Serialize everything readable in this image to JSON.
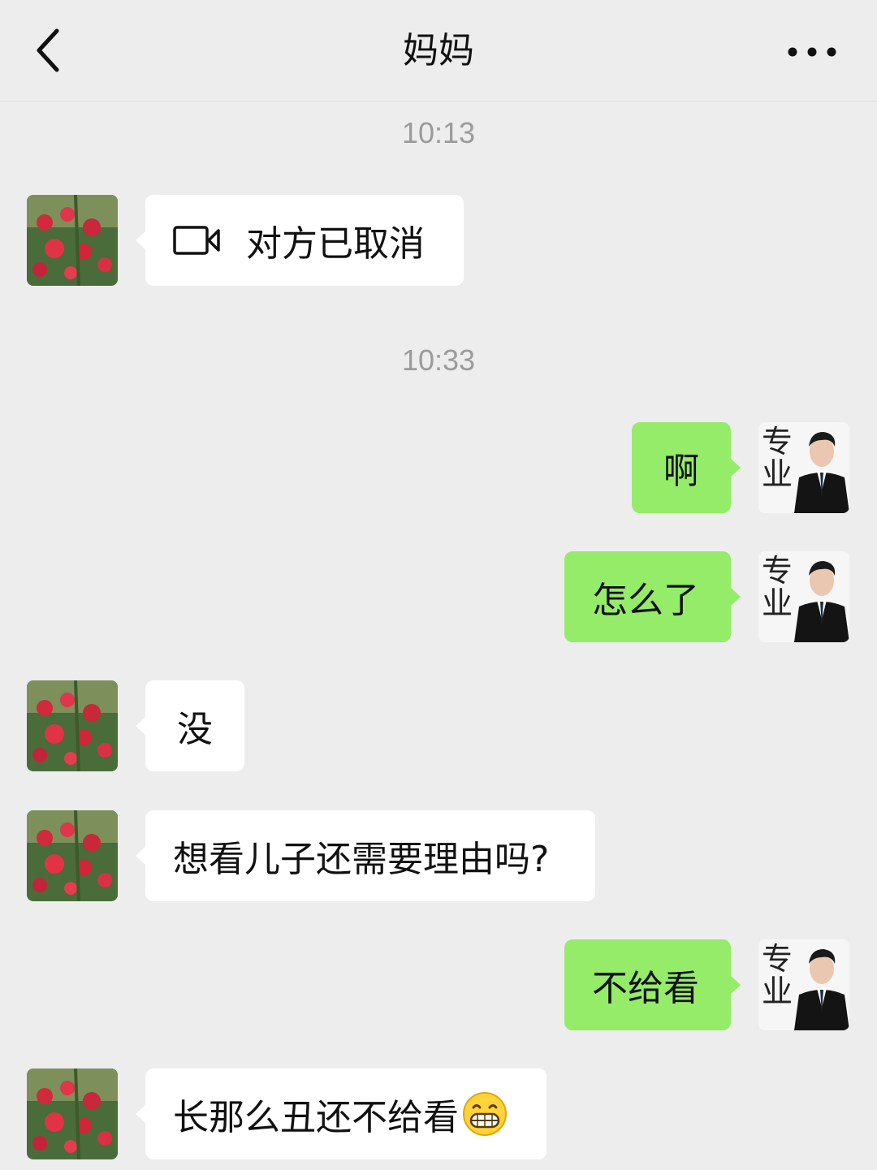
{
  "header": {
    "title": "妈妈"
  },
  "messages": {
    "time1": "10:13",
    "call_cancel_text": "对方已取消",
    "time2": "10:33",
    "m1": "啊",
    "m2": "怎么了",
    "m3": "没",
    "m4": "想看儿子还需要理由吗?",
    "m5": "不给看",
    "m6": "长那么丑还不给看"
  },
  "self_avatar": {
    "caption": "专业"
  },
  "icons": {
    "back": "chevron-left-icon",
    "more": "more-dots-icon",
    "video": "video-camera-icon",
    "emoji": "grin-emoji-icon"
  },
  "colors": {
    "background": "#ededed",
    "incoming_bubble": "#ffffff",
    "outgoing_bubble": "#95ec69",
    "timestamp": "#9b9b9b"
  }
}
